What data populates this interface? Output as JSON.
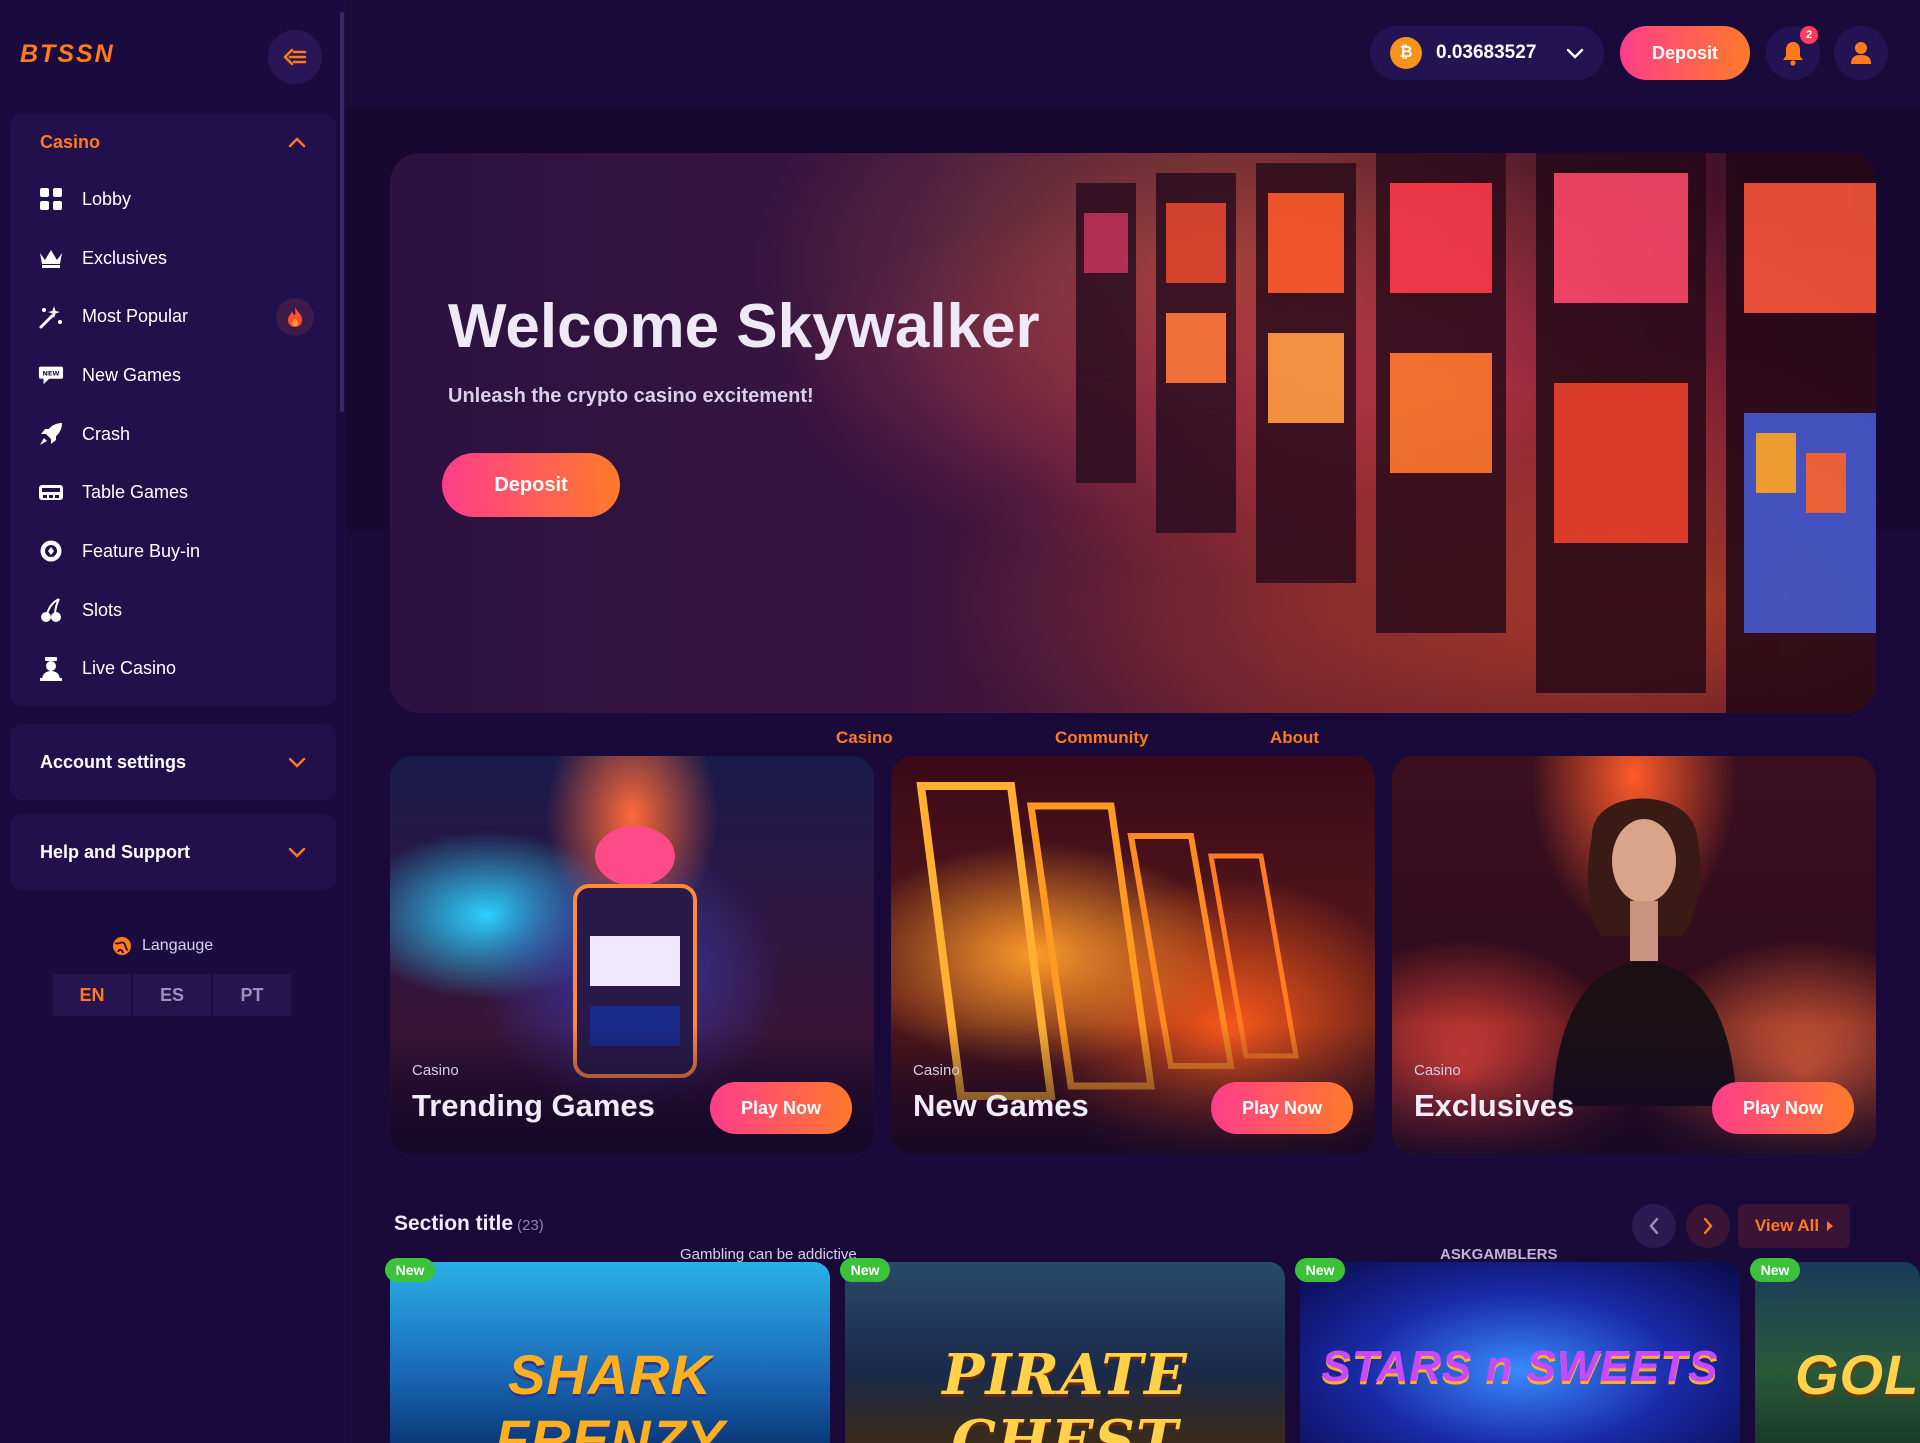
{
  "brand": {
    "logo_text": "BTSSN"
  },
  "colors": {
    "accent": "#ff7a1a",
    "gradient_start": "#ff3d8b",
    "gradient_end": "#ff7a2a",
    "background": "#1a0a3a",
    "new_badge": "#3cc23a"
  },
  "sidebar": {
    "casino_header": "Casino",
    "items": [
      {
        "label": "Lobby",
        "icon": "grid-icon"
      },
      {
        "label": "Exclusives",
        "icon": "crown-icon"
      },
      {
        "label": "Most Popular",
        "icon": "sparkle-icon",
        "badge": "fire-icon"
      },
      {
        "label": "New Games",
        "icon": "new-tag-icon"
      },
      {
        "label": "Crash",
        "icon": "rocket-icon"
      },
      {
        "label": "Table Games",
        "icon": "table-icon"
      },
      {
        "label": "Feature Buy-in",
        "icon": "coin-icon"
      },
      {
        "label": "Slots",
        "icon": "cherry-icon"
      },
      {
        "label": "Live Casino",
        "icon": "dealer-icon"
      }
    ],
    "account_settings": "Account settings",
    "help_support": "Help and Support",
    "language_title": "Langauge",
    "languages": [
      "EN",
      "ES",
      "PT"
    ],
    "active_language": "EN"
  },
  "topbar": {
    "balance": "0.03683527",
    "currency_icon": "bitcoin-icon",
    "deposit_label": "Deposit",
    "notification_count": "2"
  },
  "hero": {
    "title": "Welcome Skywalker",
    "subtitle": "Unleash the crypto casino excitement!",
    "deposit_label": "Deposit"
  },
  "footer_links": [
    "Casino",
    "Community",
    "About"
  ],
  "category_cards": [
    {
      "category": "Casino",
      "title": "Trending Games",
      "button": "Play Now"
    },
    {
      "category": "Casino",
      "title": "New Games",
      "button": "Play Now"
    },
    {
      "category": "Casino",
      "title": "Exclusives",
      "button": "Play Now"
    }
  ],
  "section": {
    "title": "Section title",
    "count": "(23)",
    "view_all": "View All",
    "gambling_note": "Gambling can be addictive",
    "askgamblers": "ASKGAMBLERS"
  },
  "games": [
    {
      "title": "SHARK FRENZY",
      "badge": "New"
    },
    {
      "title": "PIRATE CHEST",
      "badge": "New"
    },
    {
      "title": "STARS n SWEETS",
      "badge": "New"
    },
    {
      "title": "GOLD",
      "badge": "New"
    }
  ]
}
